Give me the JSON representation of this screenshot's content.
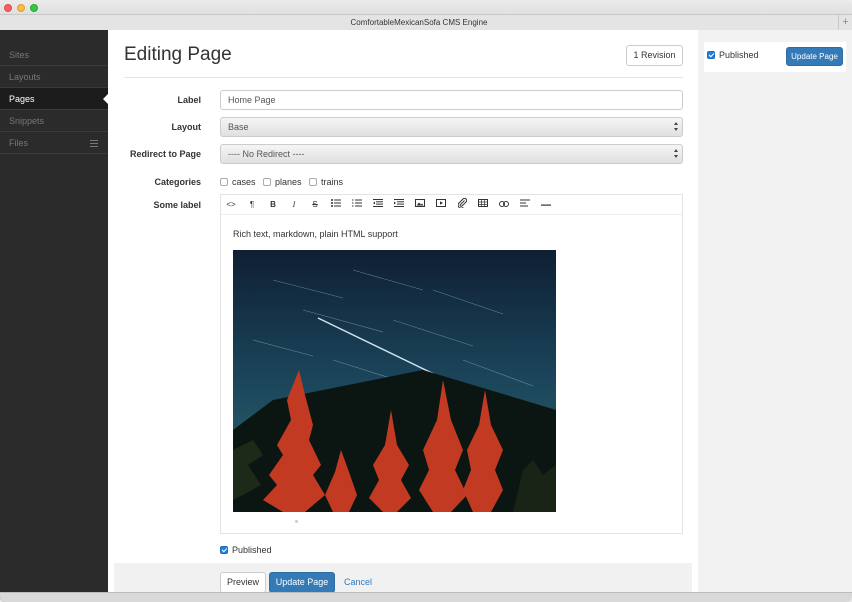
{
  "window": {
    "title": "ComfortableMexicanSofa CMS Engine",
    "new_tab": "+"
  },
  "sidebar": {
    "items": [
      {
        "label": "Sites"
      },
      {
        "label": "Layouts"
      },
      {
        "label": "Pages",
        "active": true
      },
      {
        "label": "Snippets"
      },
      {
        "label": "Files",
        "icon": "list-icon"
      }
    ]
  },
  "main": {
    "title": "Editing Page",
    "revision_button": "1 Revision",
    "fields": {
      "label": {
        "label": "Label",
        "value": "Home Page"
      },
      "layout": {
        "label": "Layout",
        "value": "Base"
      },
      "redirect": {
        "label": "Redirect to Page",
        "value": "---- No Redirect ----"
      },
      "categories": {
        "label": "Categories",
        "options": [
          "cases",
          "planes",
          "trains"
        ]
      },
      "some_label": {
        "label": "Some label"
      }
    },
    "editor": {
      "toolbar": {
        "html": "<>",
        "paragraph": "¶",
        "bold": "B",
        "italic": "I",
        "strike": "S"
      },
      "content_text": "Rich text, markdown, plain HTML support"
    },
    "published_label": "Published",
    "published_checked": true,
    "buttons": {
      "preview": "Preview",
      "update": "Update Page",
      "cancel": "Cancel"
    }
  },
  "right_panel": {
    "published_label": "Published",
    "published_checked": true,
    "update_button": "Update Page"
  },
  "colors": {
    "primary": "#337ab7",
    "sidebar_bg": "#2b2b2b",
    "checkbox": "#1a82e2"
  }
}
